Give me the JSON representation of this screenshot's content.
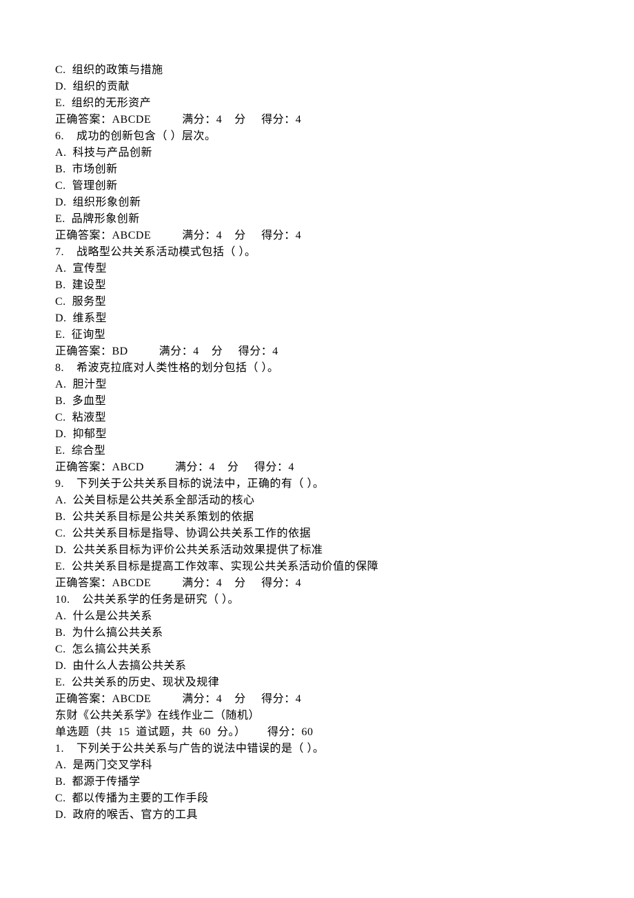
{
  "lines": [
    "C.  组织的政策与措施",
    "D.  组织的贡献",
    "E.  组织的无形资产",
    "正确答案：ABCDE          满分：4    分     得分：4",
    "6.    成功的创新包含（ ）层次。",
    "A.  科技与产品创新",
    "B.  市场创新",
    "C.  管理创新",
    "D.  组织形象创新",
    "E.  品牌形象创新",
    "正确答案：ABCDE          满分：4    分     得分：4",
    "7.    战略型公共关系活动模式包括（ ）。",
    "A.  宣传型",
    "B.  建设型",
    "C.  服务型",
    "D.  维系型",
    "E.  征询型",
    "正确答案：BD          满分：4    分     得分：4",
    "8.    希波克拉底对人类性格的划分包括（ ）。",
    "A.  胆汁型",
    "B.  多血型",
    "C.  粘液型",
    "D.  抑郁型",
    "E.  综合型",
    "正确答案：ABCD          满分：4    分     得分：4",
    "9.    下列关于公共关系目标的说法中，正确的有（ ）。",
    "A.  公关目标是公共关系全部活动的核心",
    "B.  公共关系目标是公共关系策划的依据",
    "C.  公共关系目标是指导、协调公共关系工作的依据",
    "D.  公共关系目标为评价公共关系活动效果提供了标准",
    "E.  公共关系目标是提高工作效率、实现公共关系活动价值的保障",
    "正确答案：ABCDE          满分：4    分     得分：4",
    "10.    公共关系学的任务是研究（ ）。",
    "A.  什么是公共关系",
    "B.  为什么搞公共关系",
    "C.  怎么搞公共关系",
    "D.  由什么人去搞公共关系",
    "E.  公共关系的历史、现状及规律",
    "正确答案：ABCDE          满分：4    分     得分：4",
    "东财《公共关系学》在线作业二（随机）",
    "单选题（共  15  道试题，共  60  分。）       得分：60",
    "1.    下列关于公共关系与广告的说法中错误的是（ ）。",
    "A.  是两门交叉学科",
    "B.  都源于传播学",
    "C.  都以传播为主要的工作手段",
    "D.  政府的喉舌、官方的工具"
  ]
}
